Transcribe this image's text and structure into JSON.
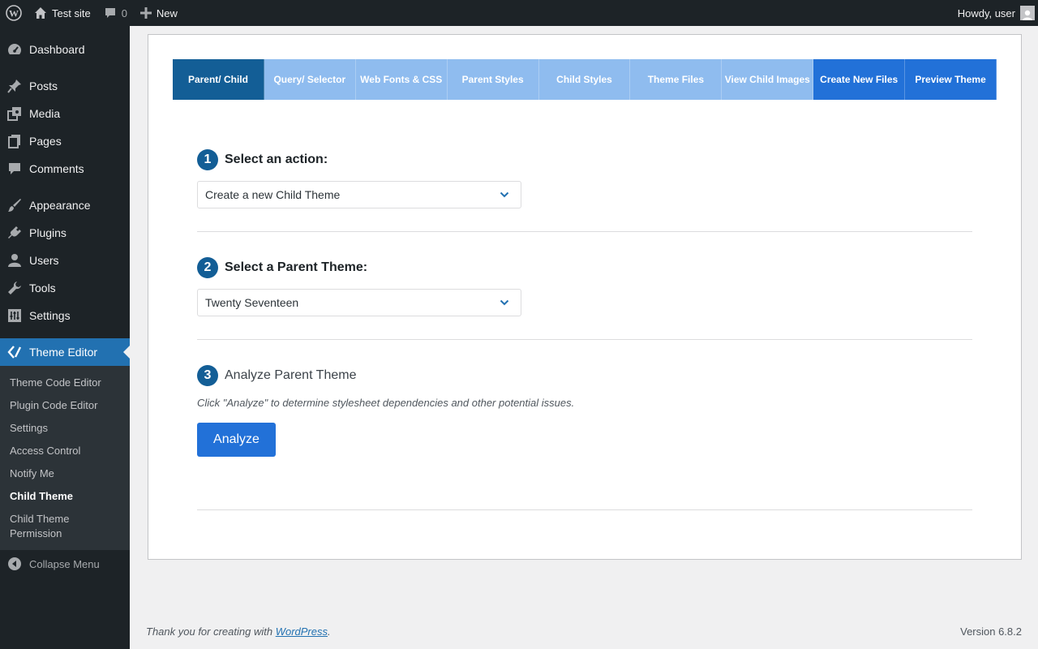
{
  "admin_bar": {
    "site_name": "Test site",
    "comments_count": "0",
    "new_label": "New",
    "greeting": "Howdy, user"
  },
  "sidebar": {
    "items": [
      {
        "label": "Dashboard",
        "icon": "dashboard-icon"
      },
      {
        "label": "Posts",
        "icon": "pushpin-icon"
      },
      {
        "label": "Media",
        "icon": "media-icon"
      },
      {
        "label": "Pages",
        "icon": "pages-icon"
      },
      {
        "label": "Comments",
        "icon": "comment-icon"
      },
      {
        "label": "Appearance",
        "icon": "paintbrush-icon"
      },
      {
        "label": "Plugins",
        "icon": "plugin-icon"
      },
      {
        "label": "Users",
        "icon": "user-icon"
      },
      {
        "label": "Tools",
        "icon": "wrench-icon"
      },
      {
        "label": "Settings",
        "icon": "settings-icon"
      },
      {
        "label": "Theme Editor",
        "icon": "theme-editor-icon"
      }
    ],
    "submenu": [
      "Theme Code Editor",
      "Plugin Code Editor",
      "Settings",
      "Access Control",
      "Notify Me",
      "Child Theme",
      "Child Theme Permission"
    ],
    "active_submenu": "Child Theme",
    "collapse_label": "Collapse Menu"
  },
  "tabs": [
    "Parent/ Child",
    "Query/ Selector",
    "Web Fonts & CSS",
    "Parent Styles",
    "Child Styles",
    "Theme Files",
    "View Child Images",
    "Create New Files",
    "Preview Theme"
  ],
  "steps": {
    "step1": {
      "num": "1",
      "title": "Select an action:",
      "value": "Create a new Child Theme"
    },
    "step2": {
      "num": "2",
      "title": "Select a Parent Theme:",
      "value": "Twenty Seventeen"
    },
    "step3": {
      "num": "3",
      "title": "Analyze Parent Theme",
      "hint": "Click \"Analyze\" to determine stylesheet dependencies and other potential issues.",
      "button": "Analyze"
    }
  },
  "footer": {
    "prefix": "Thank you for creating with ",
    "link": "WordPress",
    "suffix": ".",
    "version": "Version 6.8.2"
  },
  "colors": {
    "admin_bg": "#1d2327",
    "accent": "#2271b1",
    "tab_active": "#135e96",
    "tab_light": "#8fbcef",
    "tab_mid": "#2271d8"
  }
}
